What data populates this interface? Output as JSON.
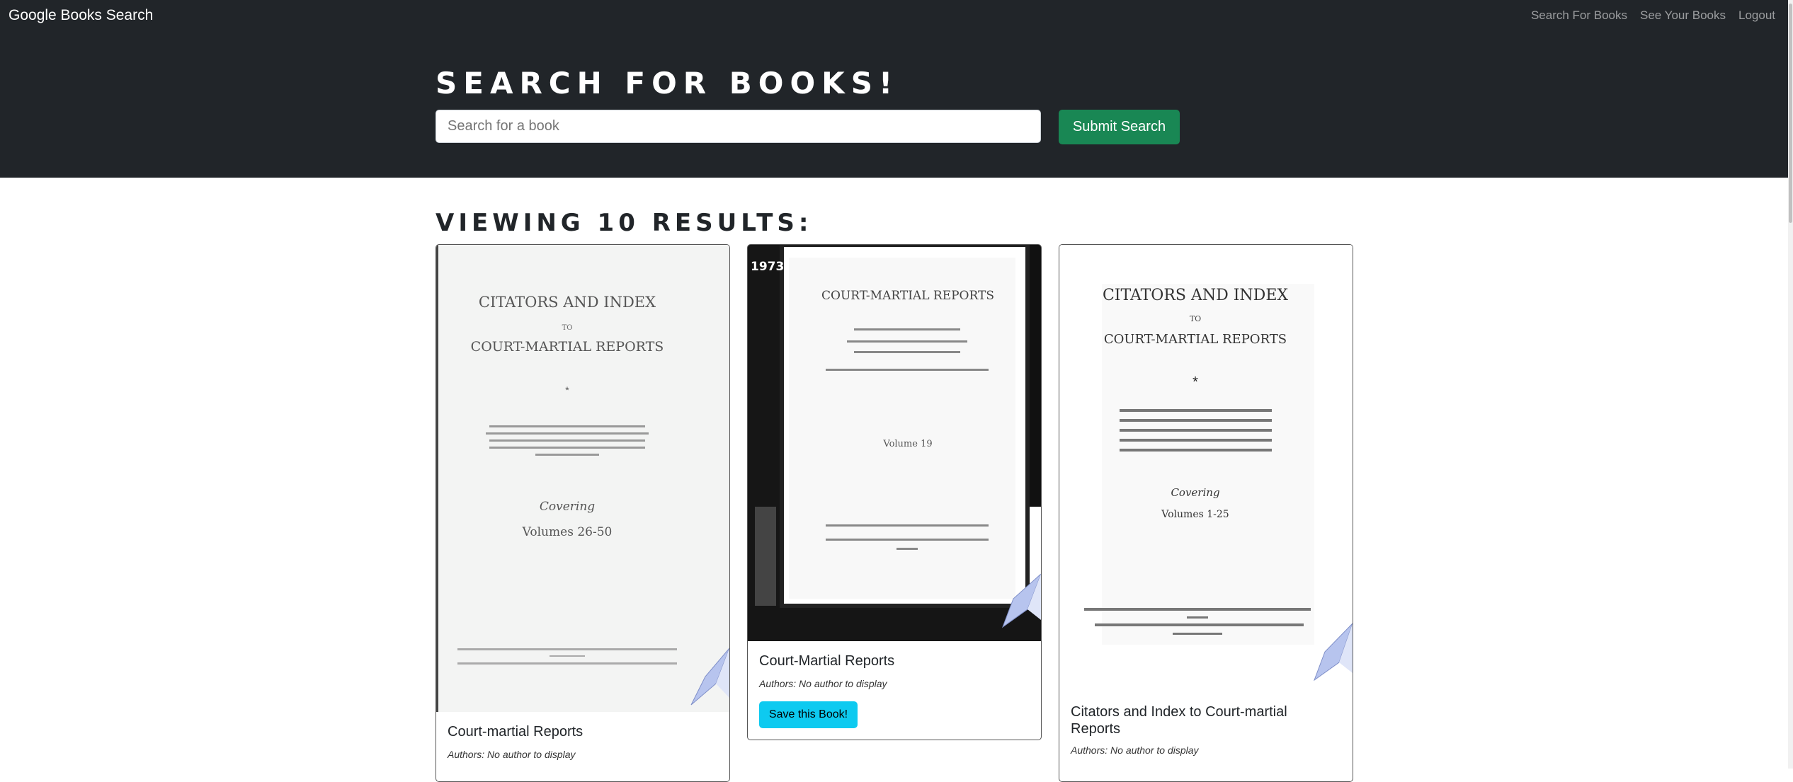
{
  "navbar": {
    "brand": "Google Books Search",
    "links": [
      "Search For Books",
      "See Your Books",
      "Logout"
    ]
  },
  "hero": {
    "title": "SEARCH FOR BOOKS!",
    "search_placeholder": "Search for a book",
    "submit_label": "Submit Search"
  },
  "results": {
    "title": "VIEWING 10 RESULTS:",
    "cards": [
      {
        "title": "Court-martial Reports",
        "authors": "Authors: No author to display",
        "cover": {
          "heading1": "CITATORS AND INDEX",
          "heading2": "TO",
          "heading3": "COURT-MARTIAL REPORTS",
          "covering": "Covering",
          "volumes": "Volumes 26-50"
        }
      },
      {
        "title": "Court-Martial Reports",
        "authors": "Authors: No author to display",
        "save_label": "Save this Book!",
        "cover": {
          "corner": "1973",
          "heading1": "COURT-MARTIAL REPORTS",
          "volume": "Volume 19"
        }
      },
      {
        "title": "Citators and Index to Court-martial Reports",
        "authors": "Authors: No author to display",
        "cover": {
          "heading1": "CITATORS AND INDEX",
          "heading2": "TO",
          "heading3": "COURT-MARTIAL REPORTS",
          "covering": "Covering",
          "volumes": "Volumes 1-25"
        }
      }
    ]
  }
}
